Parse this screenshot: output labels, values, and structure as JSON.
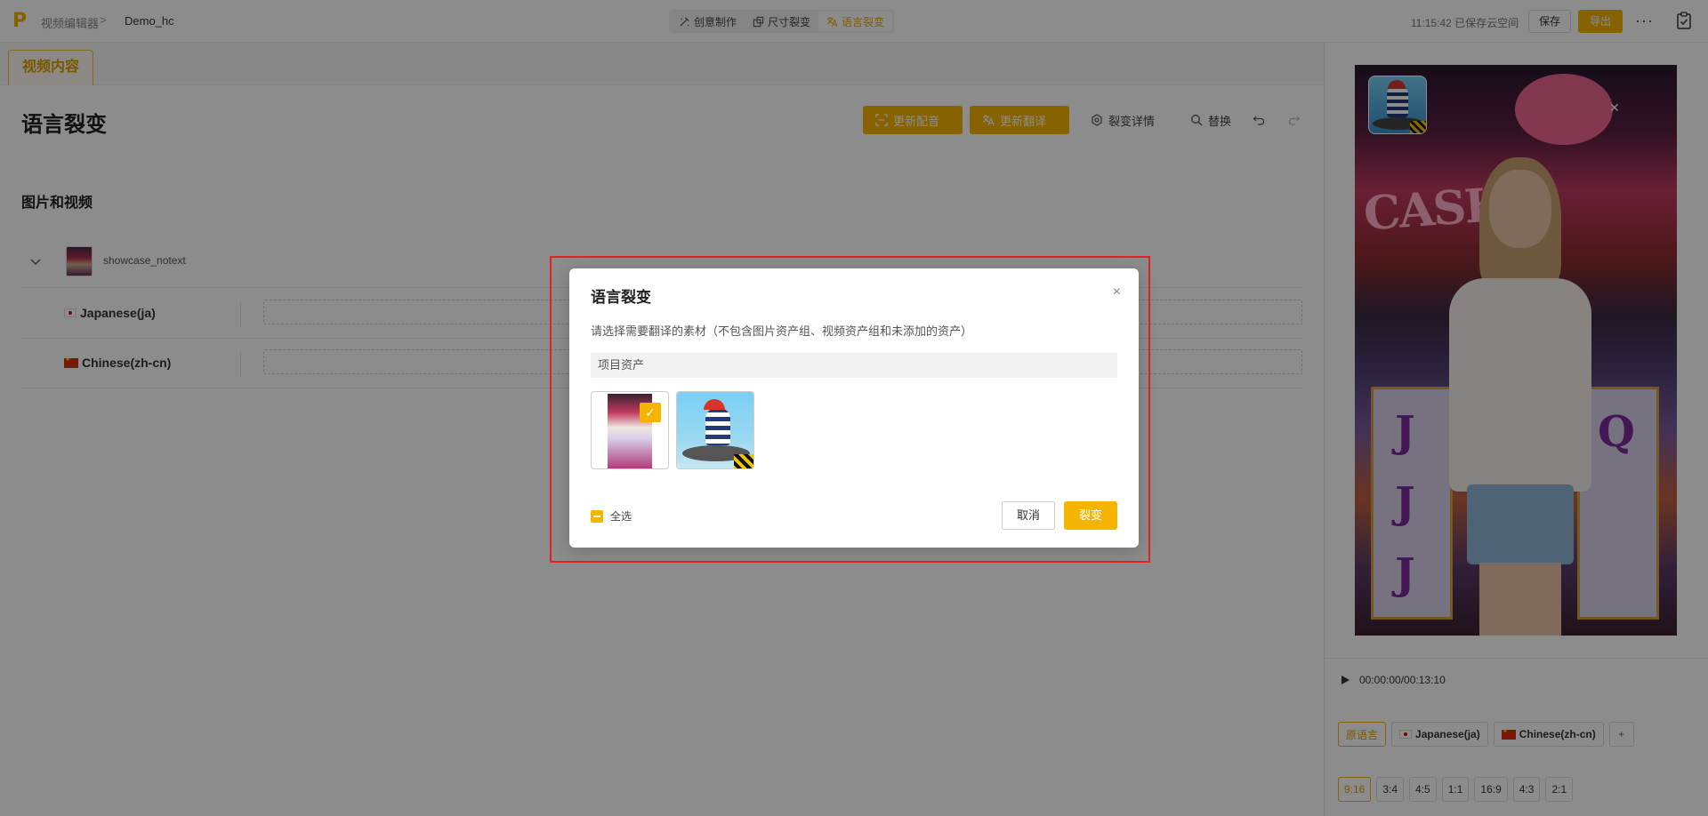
{
  "topbar": {
    "breadcrumb_root": "视频编辑器",
    "breadcrumb_sep": ">",
    "project_name": "Demo_hc",
    "modes": [
      {
        "label": "创意制作"
      },
      {
        "label": "尺寸裂变"
      },
      {
        "label": "语言裂变"
      }
    ],
    "active_mode": "语言裂变",
    "save_status": "11:15:42 已保存云空间",
    "save_label": "保存",
    "export_label": "导出",
    "more_label": "···",
    "accent_color": "#f5b400"
  },
  "editor": {
    "tab_label": "视频内容",
    "title": "语言裂变",
    "actions": {
      "update_dub": "更新配音",
      "update_translation": "更新翻译",
      "fission_detail": "裂变详情",
      "replace": "替换"
    },
    "section_title": "图片和视频",
    "asset_name": "showcase_notext",
    "languages": [
      {
        "label": "Japanese(ja)"
      },
      {
        "label": "Chinese(zh-cn)"
      }
    ]
  },
  "preview": {
    "poster_text": "CASH",
    "time": "00:00:00/00:13:10",
    "lang_chips": [
      "原语言",
      "Japanese(ja)",
      "Chinese(zh-cn)"
    ],
    "add_label": "+",
    "ratios": [
      "9:16",
      "3:4",
      "4:5",
      "1:1",
      "16:9",
      "4:3",
      "2:1"
    ],
    "selected_ratio": "9:16"
  },
  "dialog": {
    "title": "语言裂变",
    "close_label": "×",
    "description": "请选择需要翻译的素材（不包含图片资产组、视频资产组和未添加的资产）",
    "group_label": "项目资产",
    "assets": [
      {
        "selected": true
      },
      {
        "selected": false
      }
    ],
    "select_all_label": "全选",
    "cancel_label": "取消",
    "confirm_label": "裂变",
    "highlight_color": "#e52020"
  }
}
